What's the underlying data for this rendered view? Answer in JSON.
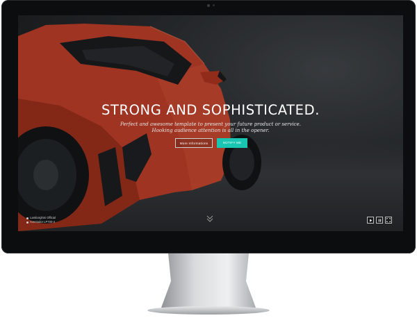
{
  "hero": {
    "title": "STRONG AND SOPHISTICATED.",
    "subtitle_line1": "Perfect and awesome template to present your future product or service.",
    "subtitle_line2": "Hooking audience attention is all in the opener."
  },
  "buttons": {
    "more_info": "More Informations",
    "accent": "Notify me"
  },
  "credits": {
    "line1": "Lamborghini Official",
    "line2": "Aventador LP700-4"
  },
  "icons": {
    "scroll": "chevron-double-down-icon",
    "play": "play-icon",
    "pause": "pause-icon",
    "fullscreen": "fullscreen-icon"
  },
  "colors": {
    "accent": "#19c6b1",
    "car": "#d9442a",
    "bezel": "#0c0d0e"
  }
}
